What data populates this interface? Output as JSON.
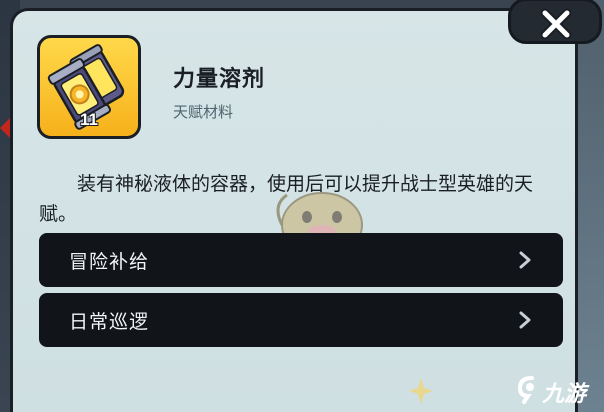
{
  "item": {
    "name": "力量溶剂",
    "type": "天赋材料",
    "count": "11",
    "icon": "potion-canisters-icon",
    "description": "装有神秘液体的容器，使用后可以提升战士型英雄的天赋。"
  },
  "menu": {
    "items": [
      {
        "label": "冒险补给",
        "icon": "chevron-right-icon"
      },
      {
        "label": "日常巡逻",
        "icon": "chevron-right-icon"
      }
    ]
  },
  "close": {
    "icon": "close-icon"
  },
  "watermark": {
    "text": "九游",
    "logo": "jiuyou-logo"
  },
  "colors": {
    "panel": "#d7e5e7",
    "row": "#111418",
    "icon_bg": "#f6b11b",
    "border": "#1a1f26"
  }
}
